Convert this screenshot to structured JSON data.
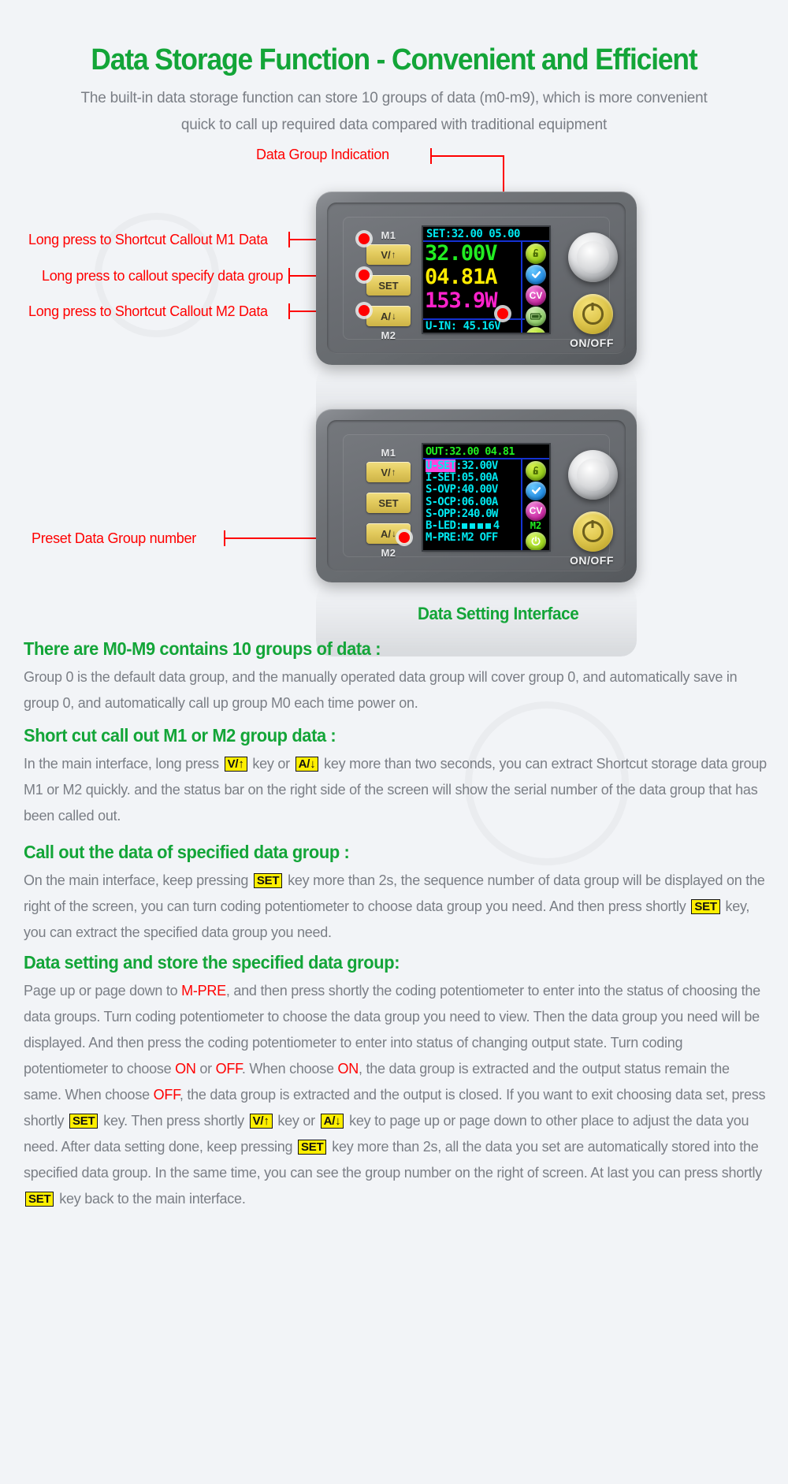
{
  "header": {
    "title": "Data Storage Function - Convenient and Efficient",
    "subtitle_line1": "The built-in data storage function can store 10 groups of data (m0-m9), which is more convenient",
    "subtitle_line2": "quick to call up required data compared with traditional equipment"
  },
  "callouts": {
    "data_group_indication": "Data Group Indication",
    "m1_shortcut": "Long press to Shortcut Callout M1 Data",
    "specify_group": "Long press to callout specify data group",
    "m2_shortcut": "Long press to Shortcut Callout M2 Data",
    "preset_group_number": "Preset Data Group number"
  },
  "device_main": {
    "label_top": "M1",
    "label_bottom": "M2",
    "keys": [
      {
        "name": "v-up-key",
        "label": "V/",
        "arrow": "↑"
      },
      {
        "name": "set-key",
        "label": "SET",
        "arrow": ""
      },
      {
        "name": "a-down-key",
        "label": "A/",
        "arrow": "↓"
      }
    ],
    "screen": {
      "topline": "SET:32.00 05.00",
      "voltage": "32.00V",
      "current": "04.81A",
      "power": "153.9W",
      "input": "U-IN: 45.16V",
      "status_icons": [
        "lock-icon",
        "check-icon",
        "cv-icon",
        "battery-icon",
        "power-icon"
      ]
    },
    "onoff_label": "ON/OFF"
  },
  "device_setting": {
    "label_top": "M1",
    "label_bottom": "M2",
    "keys": [
      {
        "name": "v-up-key",
        "label": "V/",
        "arrow": "↑"
      },
      {
        "name": "set-key",
        "label": "SET",
        "arrow": ""
      },
      {
        "name": "a-down-key",
        "label": "A/",
        "arrow": "↓"
      }
    ],
    "screen": {
      "topline": "OUT:32.00 04.81",
      "rows": [
        {
          "key": "U-SET",
          "value": ":32.00V",
          "highlight": true
        },
        {
          "key": "I-SET",
          "value": ":05.00A",
          "highlight": false
        },
        {
          "key": "S-OVP",
          "value": ":40.00V",
          "highlight": false
        },
        {
          "key": "S-OCP",
          "value": ":06.00A",
          "highlight": false
        },
        {
          "key": "S-OPP",
          "value": ":240.0W",
          "highlight": false
        },
        {
          "key": "B-LED",
          "value": ":",
          "bars": 4,
          "bars_value": "4",
          "highlight": false
        },
        {
          "key": "M-PRE",
          "value": ":M2 OFF",
          "highlight": false
        }
      ],
      "status_icons": [
        "lock-icon",
        "check-icon",
        "cv-icon",
        "power-icon"
      ],
      "group_tag": "M2"
    },
    "onoff_label": "ON/OFF",
    "caption": "Data Setting Interface"
  },
  "sections": [
    {
      "heading": "There are M0-M9 contains 10 groups of data :",
      "paragraph_parts": [
        {
          "t": "Group 0 is the default data group, and the manually operated data group will cover group 0, and automatically save in group 0, and automatically call up group M0 each time power on."
        }
      ]
    },
    {
      "heading": "Short cut call out M1 or M2 group data :",
      "paragraph_parts": [
        {
          "t": "In the main interface, long press "
        },
        {
          "kbd": "V/↑"
        },
        {
          "t": " key or "
        },
        {
          "kbd": "A/↓"
        },
        {
          "t": " key more than two seconds, you can extract Shortcut storage data group M1 or M2 quickly. and the status bar on the right side of the screen will show the serial number of the data group that has been called out."
        }
      ]
    },
    {
      "heading": "Call out the data of specified data group :",
      "paragraph_parts": [
        {
          "t": "On the main interface, keep pressing "
        },
        {
          "kbd": "SET"
        },
        {
          "t": " key more than 2s, the sequence number of data group will be displayed on the right of the screen, you can turn coding potentiometer to choose data group you need. And then press shortly "
        },
        {
          "kbd": "SET"
        },
        {
          "t": " key, you can extract the specified data group you need."
        }
      ]
    },
    {
      "heading": "Data setting and store the specified data group:",
      "paragraph_parts": [
        {
          "t": "Page up or page down to "
        },
        {
          "red": "M-PRE"
        },
        {
          "t": ", and then press shortly the coding potentiometer to enter into the status of choosing the data groups. Turn coding potentiometer to choose the data group you need to view. Then the data group you need will be displayed. And then press the coding potentiometer to enter into status of changing output state. Turn coding potentiometer to choose "
        },
        {
          "red": "ON"
        },
        {
          "t": " or "
        },
        {
          "red": "OFF"
        },
        {
          "t": ". When choose "
        },
        {
          "red": "ON"
        },
        {
          "t": ", the data group is extracted and the output status remain the same. When choose "
        },
        {
          "red": "OFF"
        },
        {
          "t": ", the data group is extracted and the output is closed. If you want to exit choosing data set, press shortly "
        },
        {
          "kbd": "SET"
        },
        {
          "t": " key. Then press shortly "
        },
        {
          "kbd": "V/↑"
        },
        {
          "t": " key or "
        },
        {
          "kbd": "A/↓"
        },
        {
          "t": " key to page up or page down to other place to adjust the data you need. After data setting done, keep pressing "
        },
        {
          "kbd": "SET"
        },
        {
          "t": " key more than 2s, all the data you set are automatically stored into the specified data group. In the same time, you can see the group number on the right of screen. At last you can press shortly "
        },
        {
          "kbd": "SET"
        },
        {
          "t": " key back to the main interface."
        }
      ]
    }
  ],
  "colors": {
    "brand_green": "#13a538",
    "callout_red": "#ff0000",
    "key_yellow": "#ffef00",
    "lcd_cyan": "#00e8f0",
    "lcd_green": "#22ee22",
    "lcd_yellow": "#ffec00",
    "lcd_magenta": "#ff22cc",
    "page_bg": "#f2f4f7"
  }
}
